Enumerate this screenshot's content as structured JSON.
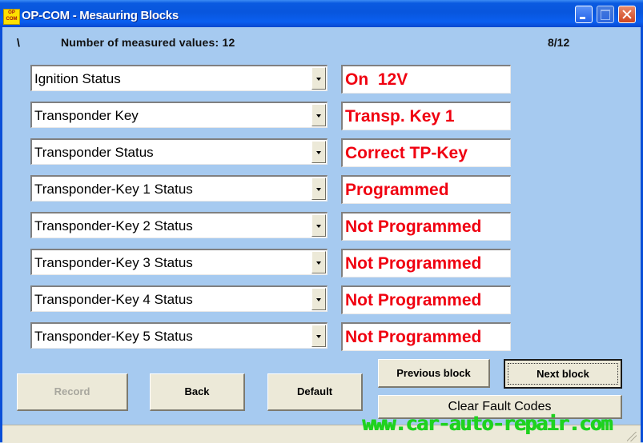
{
  "window": {
    "title": "OP-COM - Mesauring Blocks",
    "icon_text": [
      "OP",
      "COM"
    ],
    "controls": [
      "minimize",
      "maximize",
      "close"
    ]
  },
  "header": {
    "spinner": "\\",
    "count_label": "Number of measured values: 12",
    "page": "8/12"
  },
  "rows": [
    {
      "name": "Ignition Status",
      "value": "On  12V"
    },
    {
      "name": "Transponder Key",
      "value": "Transp. Key 1"
    },
    {
      "name": "Transponder Status",
      "value": "Correct TP-Key"
    },
    {
      "name": "Transponder-Key 1 Status",
      "value": "Programmed"
    },
    {
      "name": "Transponder-Key 2 Status",
      "value": "Not Programmed"
    },
    {
      "name": "Transponder-Key 3 Status",
      "value": "Not Programmed"
    },
    {
      "name": "Transponder-Key 4 Status",
      "value": "Not Programmed"
    },
    {
      "name": "Transponder-Key 5 Status",
      "value": "Not Programmed"
    }
  ],
  "buttons": {
    "record": "Record",
    "back": "Back",
    "default": "Default",
    "previous_block": "Previous block",
    "next_block": "Next block",
    "clear_fault_codes": "Clear Fault Codes"
  },
  "colors": {
    "value_text": "#f00010",
    "background": "#a6caf0",
    "watermark": "#1fd21f"
  },
  "watermark": "www.car-auto-repair.com"
}
